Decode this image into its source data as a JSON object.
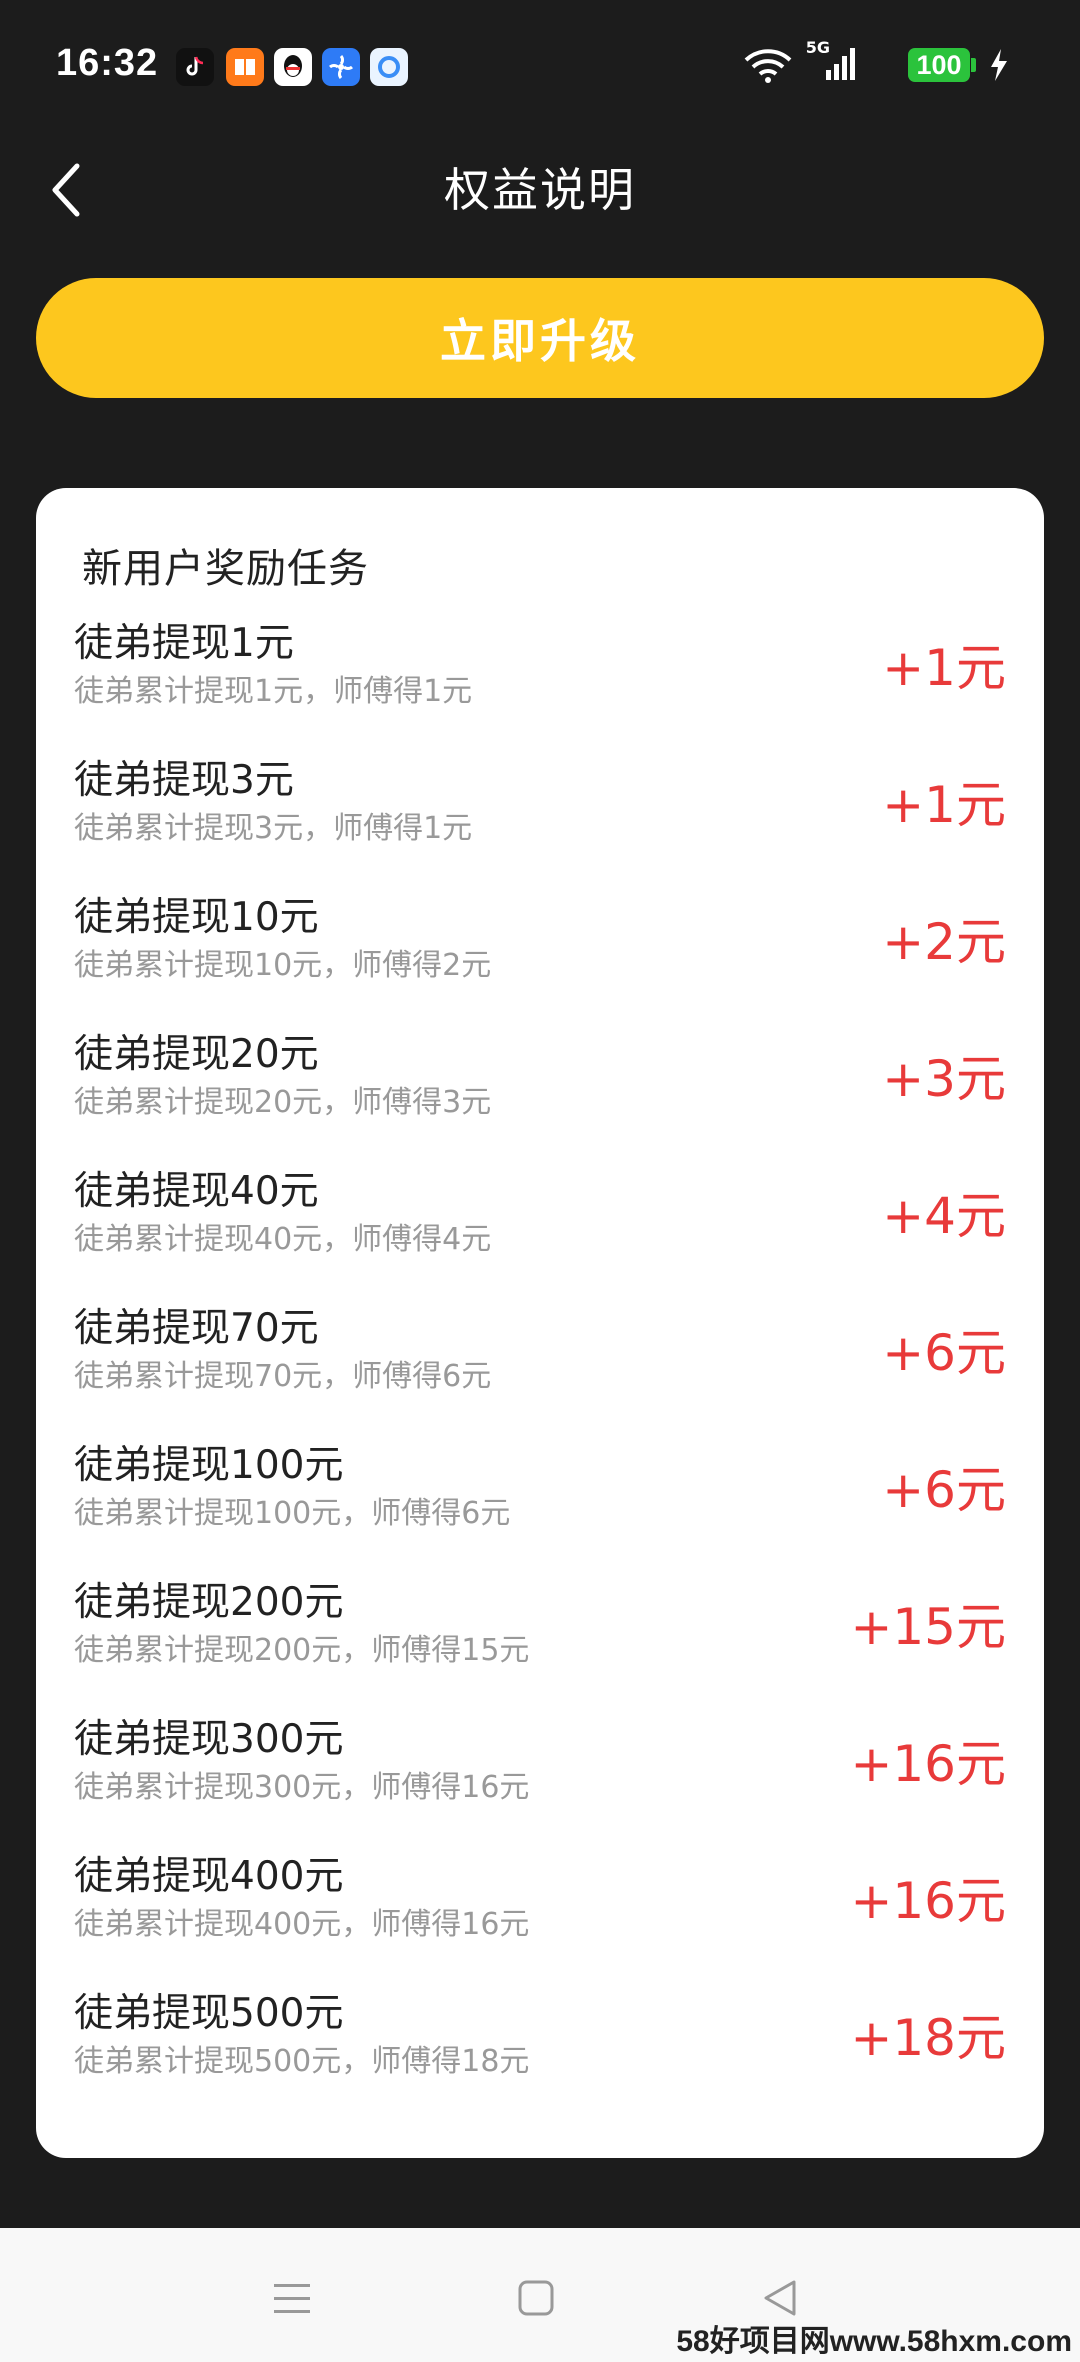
{
  "status_bar": {
    "time": "16:32",
    "network": "5G",
    "battery": "100",
    "app_icons": [
      "tiktok-icon",
      "books-icon",
      "qq-icon",
      "fan-icon",
      "browser-icon"
    ]
  },
  "header": {
    "title": "权益说明",
    "back_icon": "chevron-left-icon"
  },
  "upgrade_button": {
    "label": "立即升级",
    "color": "#fdc71e"
  },
  "card": {
    "title": "新用户奖励任务",
    "reward_color": "#e83a3a",
    "tasks": [
      {
        "name": "徒弟提现1元",
        "desc": "徒弟累计提现1元，师傅得1元",
        "reward": "+1元"
      },
      {
        "name": "徒弟提现3元",
        "desc": "徒弟累计提现3元，师傅得1元",
        "reward": "+1元"
      },
      {
        "name": "徒弟提现10元",
        "desc": "徒弟累计提现10元，师傅得2元",
        "reward": "+2元"
      },
      {
        "name": "徒弟提现20元",
        "desc": "徒弟累计提现20元，师傅得3元",
        "reward": "+3元"
      },
      {
        "name": "徒弟提现40元",
        "desc": "徒弟累计提现40元，师傅得4元",
        "reward": "+4元"
      },
      {
        "name": "徒弟提现70元",
        "desc": "徒弟累计提现70元，师傅得6元",
        "reward": "+6元"
      },
      {
        "name": "徒弟提现100元",
        "desc": "徒弟累计提现100元，师傅得6元",
        "reward": "+6元"
      },
      {
        "name": "徒弟提现200元",
        "desc": "徒弟累计提现200元，师傅得15元",
        "reward": "+15元"
      },
      {
        "name": "徒弟提现300元",
        "desc": "徒弟累计提现300元，师傅得16元",
        "reward": "+16元"
      },
      {
        "name": "徒弟提现400元",
        "desc": "徒弟累计提现400元，师傅得16元",
        "reward": "+16元"
      },
      {
        "name": "徒弟提现500元",
        "desc": "徒弟累计提现500元，师傅得18元",
        "reward": "+18元"
      }
    ]
  },
  "nav_bar": {
    "buttons": [
      "menu-icon",
      "home-icon",
      "back-triangle-icon"
    ]
  },
  "watermark": "58好项目网www.58hxm.com"
}
